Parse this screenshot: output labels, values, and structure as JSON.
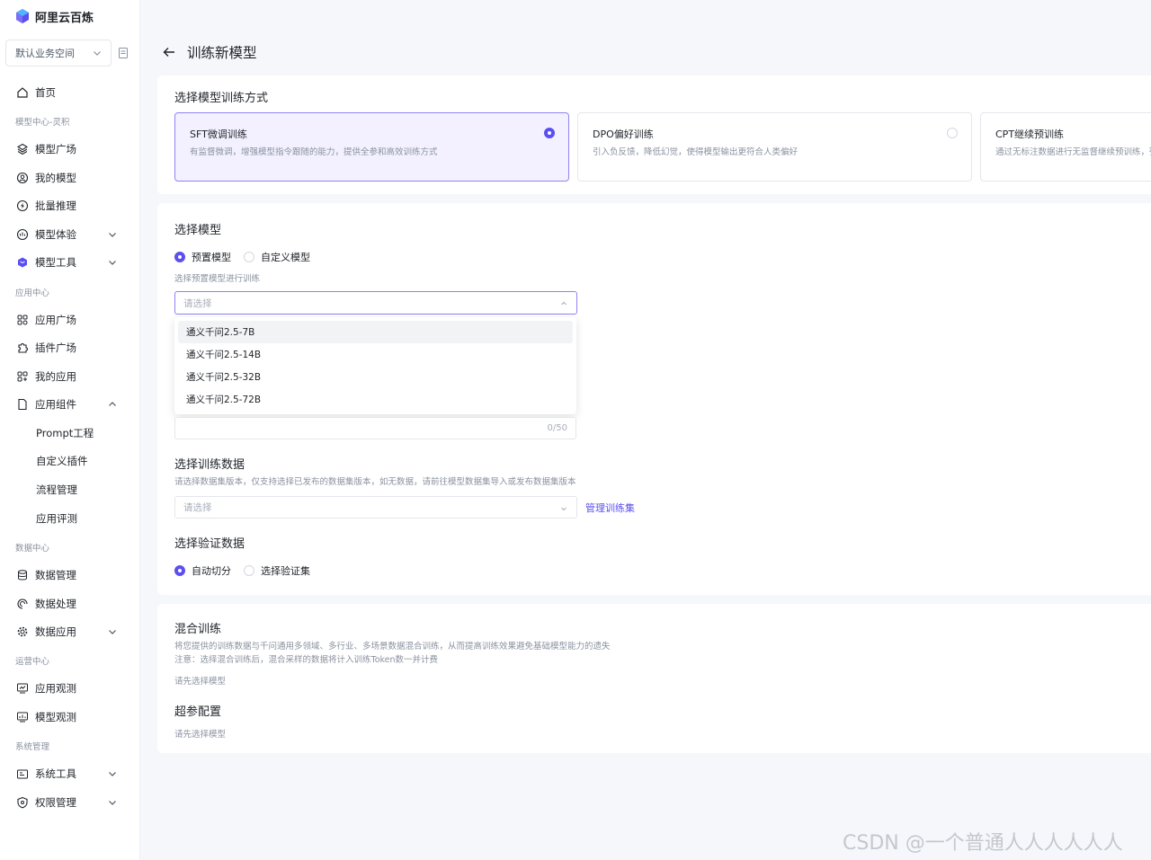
{
  "brand": {
    "name": "阿里云百炼"
  },
  "workspace": {
    "label": "默认业务空间"
  },
  "sidebar": {
    "items": [
      {
        "label": "首页"
      },
      {
        "group": "模型中心-灵积"
      },
      {
        "label": "模型广场"
      },
      {
        "label": "我的模型"
      },
      {
        "label": "批量推理"
      },
      {
        "label": "模型体验"
      },
      {
        "label": "模型工具"
      },
      {
        "group": "应用中心"
      },
      {
        "label": "应用广场"
      },
      {
        "label": "插件广场"
      },
      {
        "label": "我的应用"
      },
      {
        "label": "应用组件"
      },
      {
        "label": "Prompt工程"
      },
      {
        "label": "自定义插件"
      },
      {
        "label": "流程管理"
      },
      {
        "label": "应用评测"
      },
      {
        "group": "数据中心"
      },
      {
        "label": "数据管理"
      },
      {
        "label": "数据处理"
      },
      {
        "label": "数据应用"
      },
      {
        "group": "运营中心"
      },
      {
        "label": "应用观测"
      },
      {
        "label": "模型观测"
      },
      {
        "group": "系统管理"
      },
      {
        "label": "系统工具"
      },
      {
        "label": "权限管理"
      }
    ]
  },
  "page": {
    "title": "训练新模型"
  },
  "method": {
    "title": "选择模型训练方式",
    "options": [
      {
        "name": "SFT微调训练",
        "desc": "有监督微调，增强模型指令跟随的能力，提供全参和高效训练方式"
      },
      {
        "name": "DPO偏好训练",
        "desc": "引入负反馈，降低幻觉，使得模型输出更符合人类偏好"
      },
      {
        "name": "CPT继续预训练",
        "desc": "通过无标注数据进行无监督继续预训练，强"
      }
    ]
  },
  "model": {
    "title": "选择模型",
    "radio_preset": "预置模型",
    "radio_custom": "自定义模型",
    "hint": "选择预置模型进行训练",
    "placeholder": "请选择",
    "options": [
      "通义千问2.5-7B",
      "通义千问2.5-14B",
      "通义千问2.5-32B",
      "通义千问2.5-72B"
    ],
    "counter": "0/50"
  },
  "train_data": {
    "title": "选择训练数据",
    "hint": "请选择数据集版本，仅支持选择已发布的数据集版本，如无数据，请前往模型数据集导入或发布数据集版本",
    "placeholder": "请选择",
    "manage_link": "管理训练集"
  },
  "val_data": {
    "title": "选择验证数据",
    "radio_auto": "自动切分",
    "radio_select": "选择验证集"
  },
  "mix": {
    "title": "混合训练",
    "desc1": "将您提供的训练数据与千问通用多领域、多行业、多场景数据混合训练，从而提高训练效果避免基础模型能力的遗失",
    "desc2": "注意：选择混合训练后，混合采样的数据将计入训练Token数一并计费",
    "hint": "请先选择模型"
  },
  "hyper": {
    "title": "超参配置",
    "hint": "请先选择模型"
  },
  "watermark": "CSDN @一个普通人人人人人人",
  "colors": {
    "accent": "#5b4ff0",
    "active_bg": "#f3f1ff"
  }
}
